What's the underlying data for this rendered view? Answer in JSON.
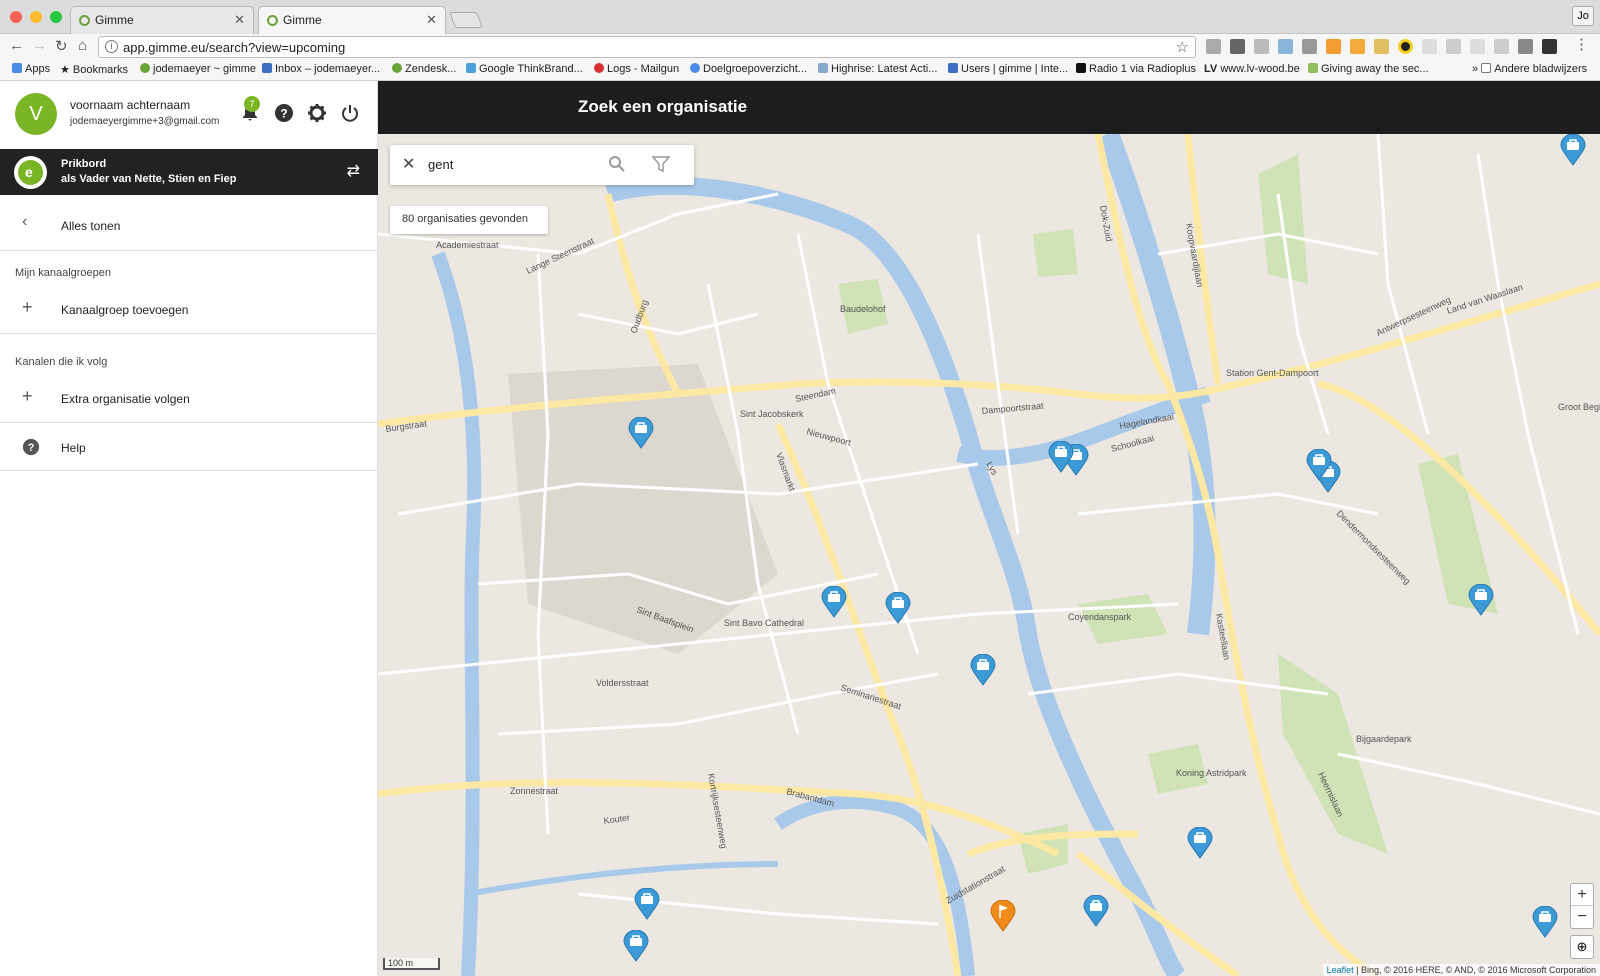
{
  "browser": {
    "tabs": [
      {
        "title": "Gimme"
      },
      {
        "title": "Gimme"
      }
    ],
    "profile": "Jo",
    "url": "app.gimme.eu/search?view=upcoming",
    "bookmarks": [
      "Apps",
      "Bookmarks",
      "jodemaeyer ~ gimme",
      "Inbox – jodemaeyer...",
      "Zendesk...",
      "Google ThinkBrand...",
      "Logs - Mailgun",
      "Doelgroepoverzicht...",
      "Highrise: Latest Acti...",
      "Users | gimme | Inte...",
      "Radio 1 via Radioplus",
      "www.lv-wood.be",
      "Giving away the sec..."
    ],
    "bookmarks_other": "Andere bladwijzers",
    "lv_prefix": "LV"
  },
  "user": {
    "initial": "V",
    "name": "voornaam achternaam",
    "email": "jodemaeyergimme+3@gmail.com",
    "notification_count": "7"
  },
  "prikbord": {
    "title": "Prikbord",
    "subtitle": "als Vader van Nette, Stien en Fiep"
  },
  "sidebar": {
    "back_label": "Alles tonen",
    "section_groups": "Mijn kanaalgroepen",
    "add_group": "Kanaalgroep toevoegen",
    "section_channels": "Kanalen die ik volg",
    "add_org": "Extra organisatie volgen",
    "help": "Help"
  },
  "main": {
    "title": "Zoek een organisatie",
    "search_value": "gent",
    "result_count": "80 organisaties gevonden",
    "scale": "100 m",
    "attribution_link": "Leaflet",
    "attribution_text": " | Bing, © 2016 HERE, © AND, © 2016 Microsoft Corporation",
    "zoom_in": "+",
    "zoom_out": "−"
  },
  "map_labels": [
    "Academiestraat",
    "Lange Steenstraat",
    "Oudburg",
    "Baudelohof",
    "Steendam",
    "Sint Jacobskerk",
    "Dampoortstraat",
    "Hagelandkaai",
    "Station Gent-Dampoort",
    "Land van Waaslaan",
    "Dok-Zuid",
    "Koopvaardijlaan",
    "Burgstraat",
    "Vlasmarkt",
    "Lys",
    "Voldersstraat",
    "Sint Baafsplein",
    "Sint Bavo Cathedral",
    "Coyendanspark",
    "Dendermondsesteenweg",
    "Kasteellaan",
    "Brabantdam",
    "Kouter",
    "Zonnestraat",
    "Zuidstationstraat",
    "Heernislaan",
    "Bijgaardepark",
    "Koning Astridpark",
    "Schoolkaai",
    "Nieuwpoort",
    "Groot Begijnhof",
    "Antwerpsesteenweg",
    "Seminariestraat",
    "Kortrijksesteenweg"
  ],
  "colors": {
    "accent_green": "#7ab526",
    "appbar": "#1d1d1d",
    "pin_blue": "#3c9ad6",
    "pin_orange": "#f08a1b",
    "water": "#a9c9ea",
    "road": "#fde8a3"
  },
  "pins": [
    {
      "type": "org"
    },
    {
      "type": "org"
    },
    {
      "type": "org"
    },
    {
      "type": "org"
    },
    {
      "type": "org"
    },
    {
      "type": "org"
    },
    {
      "type": "org"
    },
    {
      "type": "org"
    },
    {
      "type": "org"
    },
    {
      "type": "org"
    },
    {
      "type": "org"
    },
    {
      "type": "org"
    },
    {
      "type": "event"
    },
    {
      "type": "org"
    },
    {
      "type": "org"
    },
    {
      "type": "org"
    }
  ]
}
